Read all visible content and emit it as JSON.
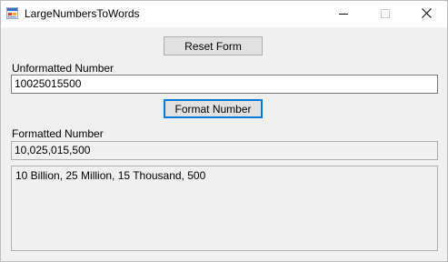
{
  "window": {
    "title": "LargeNumbersToWords"
  },
  "form": {
    "reset_label": "Reset Form",
    "unformatted_label": "Unformatted Number",
    "unformatted_value": "10025015500",
    "format_label": "Format Number",
    "formatted_label": "Formatted Number",
    "formatted_value": "10,025,015,500",
    "words_value": "10 Billion, 25 Million, 15 Thousand, 500"
  },
  "icons": {
    "app": "form-app-icon",
    "minimize": "minimize-icon",
    "maximize": "maximize-icon",
    "close": "close-icon"
  },
  "colors": {
    "focus_accent": "#0078d7",
    "window_bg": "#f0f0f0"
  }
}
